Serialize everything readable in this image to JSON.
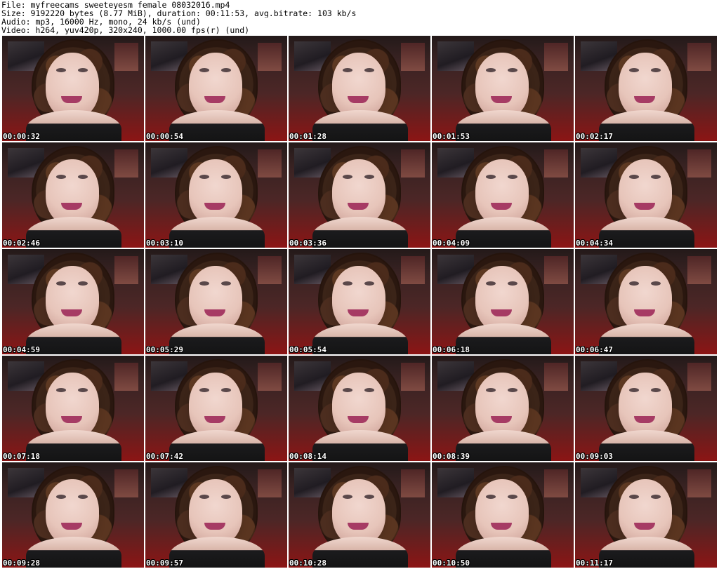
{
  "header": {
    "file": "File: myfreecams_sweeteyesm_female_08032016.mp4",
    "size": "Size: 9192220 bytes (8.77 MiB), duration: 00:11:53, avg.bitrate: 103 kb/s",
    "audio": "Audio: mp3, 16000 Hz, mono, 24 kb/s (und)",
    "video": "Video: h264, yuv420p, 320x240, 1000.00 fps(r) (und)"
  },
  "thumbnails": [
    {
      "timestamp": "00:00:32"
    },
    {
      "timestamp": "00:00:54"
    },
    {
      "timestamp": "00:01:28"
    },
    {
      "timestamp": "00:01:53"
    },
    {
      "timestamp": "00:02:17"
    },
    {
      "timestamp": "00:02:46"
    },
    {
      "timestamp": "00:03:10"
    },
    {
      "timestamp": "00:03:36"
    },
    {
      "timestamp": "00:04:09"
    },
    {
      "timestamp": "00:04:34"
    },
    {
      "timestamp": "00:04:59"
    },
    {
      "timestamp": "00:05:29"
    },
    {
      "timestamp": "00:05:54"
    },
    {
      "timestamp": "00:06:18"
    },
    {
      "timestamp": "00:06:47"
    },
    {
      "timestamp": "00:07:18"
    },
    {
      "timestamp": "00:07:42"
    },
    {
      "timestamp": "00:08:14"
    },
    {
      "timestamp": "00:08:39"
    },
    {
      "timestamp": "00:09:03"
    },
    {
      "timestamp": "00:09:28"
    },
    {
      "timestamp": "00:09:57"
    },
    {
      "timestamp": "00:10:28"
    },
    {
      "timestamp": "00:10:50"
    },
    {
      "timestamp": "00:11:17"
    }
  ]
}
